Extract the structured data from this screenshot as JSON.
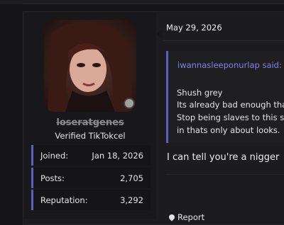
{
  "post": {
    "date": "May 29, 2026",
    "message": "I can tell you're a nigger"
  },
  "user": {
    "username": "loseratgenes",
    "title": "Verified TikTokcel",
    "stats": [
      {
        "label": "Joined:",
        "value": "Jan 18, 2026"
      },
      {
        "label": "Posts:",
        "value": "2,705"
      },
      {
        "label": "Reputation:",
        "value": "3,292"
      }
    ]
  },
  "quote": {
    "author": "iwannasleeponurlap said:",
    "lines": [
      "Shush grey",
      "Its already bad enough tha",
      "Stop being slaves to this sc",
      "in thats only about looks."
    ]
  },
  "actions": {
    "report": "Report"
  },
  "colors": {
    "accent": "#5b5fbf",
    "quote_author": "#7f83e6",
    "background": "#141416"
  }
}
